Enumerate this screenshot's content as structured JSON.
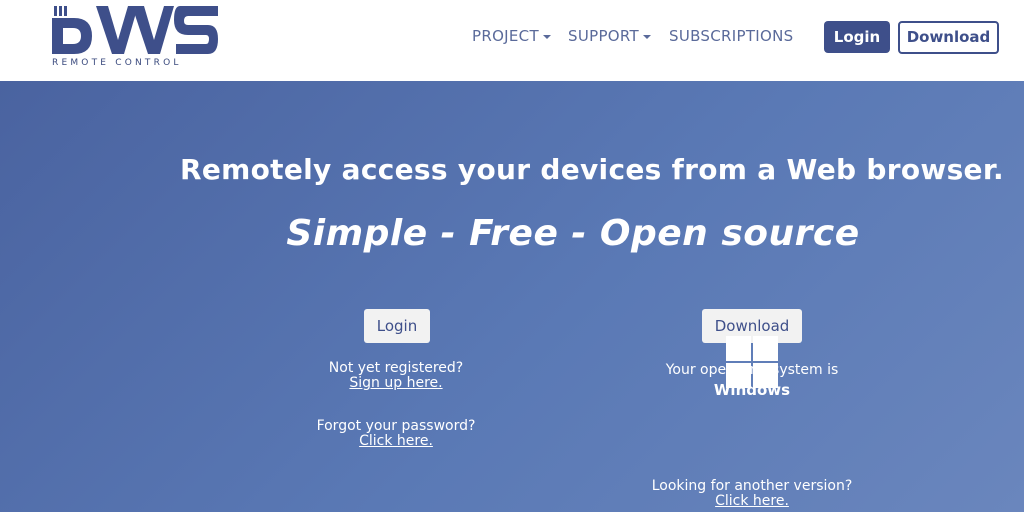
{
  "brand": {
    "logo_text": "DWS",
    "subtitle": "REMOTE CONTROL",
    "color": "#3e4f8a"
  },
  "nav": {
    "project": "PROJECT",
    "support": "SUPPORT",
    "subscriptions": "SUBSCRIPTIONS",
    "login": "Login",
    "download": "Download"
  },
  "hero": {
    "headline": "Remotely access your devices from a Web browser.",
    "tagline": "Simple - Free - Open source",
    "background": "#5a79b5"
  },
  "login_panel": {
    "button": "Login",
    "not_registered": "Not yet registered?",
    "signup_link": "Sign up here.",
    "forgot": "Forgot your password?",
    "forgot_link": "Click here."
  },
  "download_panel": {
    "button": "Download",
    "os_text": "Your operating system is",
    "os_name": "Windows",
    "os_icon": "windows-icon",
    "other_version": "Looking for another version?",
    "other_link": "Click here."
  }
}
